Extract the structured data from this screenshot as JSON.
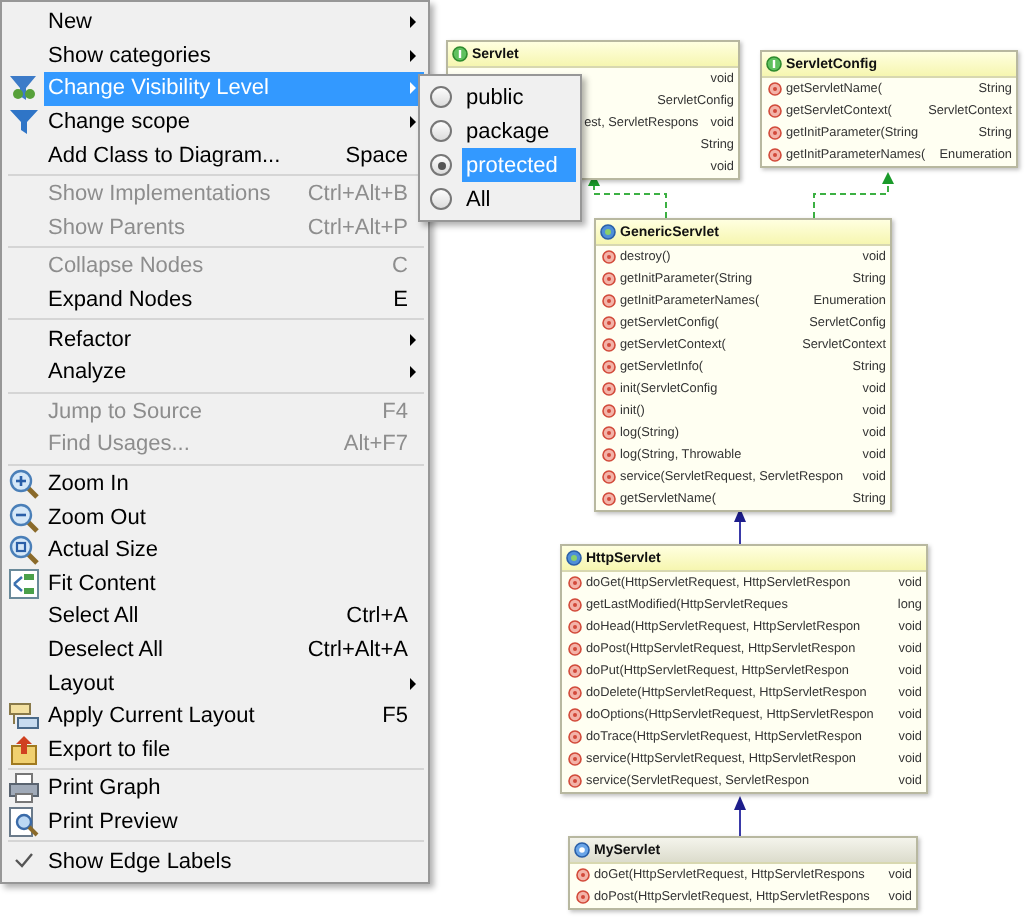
{
  "menu": {
    "items": [
      {
        "kind": "item",
        "label": "New",
        "submenu": true,
        "disabled": false,
        "selected": false
      },
      {
        "kind": "item",
        "label": "Show categories",
        "submenu": true,
        "disabled": false,
        "selected": false
      },
      {
        "kind": "item",
        "label": "Change Visibility Level",
        "submenu": true,
        "disabled": false,
        "selected": true
      },
      {
        "kind": "item",
        "label": "Change scope",
        "submenu": true,
        "disabled": false,
        "selected": false
      },
      {
        "kind": "item",
        "label": "Add Class to Diagram...",
        "shortcut": "Space",
        "submenu": false,
        "disabled": false,
        "selected": false
      },
      {
        "kind": "separator"
      },
      {
        "kind": "item",
        "label": "Show Implementations",
        "shortcut": "Ctrl+Alt+B",
        "submenu": false,
        "disabled": true,
        "selected": false
      },
      {
        "kind": "item",
        "label": "Show Parents",
        "shortcut": "Ctrl+Alt+P",
        "submenu": false,
        "disabled": true,
        "selected": false
      },
      {
        "kind": "separator"
      },
      {
        "kind": "item",
        "label": "Collapse Nodes",
        "shortcut": "C",
        "submenu": false,
        "disabled": true,
        "selected": false
      },
      {
        "kind": "item",
        "label": "Expand Nodes",
        "shortcut": "E",
        "submenu": false,
        "disabled": false,
        "selected": false
      },
      {
        "kind": "separator"
      },
      {
        "kind": "item",
        "label": "Refactor",
        "submenu": true,
        "disabled": false,
        "selected": false
      },
      {
        "kind": "item",
        "label": "Analyze",
        "submenu": true,
        "disabled": false,
        "selected": false
      },
      {
        "kind": "separator"
      },
      {
        "kind": "item",
        "label": "Jump to Source",
        "shortcut": "F4",
        "submenu": false,
        "disabled": true,
        "selected": false
      },
      {
        "kind": "item",
        "label": "Find Usages...",
        "shortcut": "Alt+F7",
        "submenu": false,
        "disabled": true,
        "selected": false
      },
      {
        "kind": "separator"
      },
      {
        "kind": "item",
        "label": "Zoom In",
        "submenu": false,
        "disabled": false,
        "selected": false
      },
      {
        "kind": "item",
        "label": "Zoom Out",
        "submenu": false,
        "disabled": false,
        "selected": false
      },
      {
        "kind": "item",
        "label": "Actual Size",
        "submenu": false,
        "disabled": false,
        "selected": false
      },
      {
        "kind": "item",
        "label": "Fit Content",
        "submenu": false,
        "disabled": false,
        "selected": false
      },
      {
        "kind": "item",
        "label": "Select All",
        "shortcut": "Ctrl+A",
        "submenu": false,
        "disabled": false,
        "selected": false
      },
      {
        "kind": "item",
        "label": "Deselect All",
        "shortcut": "Ctrl+Alt+A",
        "submenu": false,
        "disabled": false,
        "selected": false
      },
      {
        "kind": "item",
        "label": "Layout",
        "submenu": true,
        "disabled": false,
        "selected": false
      },
      {
        "kind": "item",
        "label": "Apply Current Layout",
        "shortcut": "F5",
        "submenu": false,
        "disabled": false,
        "selected": false
      },
      {
        "kind": "item",
        "label": "Export to file",
        "submenu": false,
        "disabled": false,
        "selected": false
      },
      {
        "kind": "separator"
      },
      {
        "kind": "item",
        "label": "Print Graph",
        "submenu": false,
        "disabled": false,
        "selected": false
      },
      {
        "kind": "item",
        "label": "Print Preview",
        "submenu": false,
        "disabled": false,
        "selected": false
      },
      {
        "kind": "separator"
      },
      {
        "kind": "item",
        "label": "Show Edge Labels",
        "submenu": false,
        "disabled": false,
        "selected": false,
        "checked": true
      }
    ]
  },
  "submenu": {
    "items": [
      {
        "label": "public",
        "selected": false
      },
      {
        "label": "package",
        "selected": false
      },
      {
        "label": "protected",
        "selected": true
      },
      {
        "label": "All",
        "selected": false
      }
    ]
  },
  "diagram": {
    "classes": [
      {
        "name": "Servlet",
        "kind": "interface",
        "members": [
          {
            "type": "void"
          },
          {
            "type": "ServletConfig"
          },
          {
            "name": "est, ServletRespons",
            "type": "void"
          },
          {
            "type": "String"
          },
          {
            "type": "void"
          }
        ]
      },
      {
        "name": "ServletConfig",
        "kind": "interface",
        "members": [
          {
            "name": "getServletName(",
            "type": "String"
          },
          {
            "name": "getServletContext(",
            "type": "ServletContext"
          },
          {
            "name": "getInitParameter(String",
            "type": "String"
          },
          {
            "name": "getInitParameterNames(",
            "type": "Enumeration"
          }
        ]
      },
      {
        "name": "GenericServlet",
        "kind": "abstract",
        "members": [
          {
            "name": "destroy()",
            "type": "void"
          },
          {
            "name": "getInitParameter(String",
            "type": "String"
          },
          {
            "name": "getInitParameterNames(",
            "type": "Enumeration"
          },
          {
            "name": "getServletConfig(",
            "type": "ServletConfig"
          },
          {
            "name": "getServletContext(",
            "type": "ServletContext"
          },
          {
            "name": "getServletInfo(",
            "type": "String"
          },
          {
            "name": "init(ServletConfig",
            "type": "void"
          },
          {
            "name": "init()",
            "type": "void"
          },
          {
            "name": "log(String)",
            "type": "void"
          },
          {
            "name": "log(String, Throwable",
            "type": "void"
          },
          {
            "name": "service(ServletRequest, ServletRespon",
            "type": "void"
          },
          {
            "name": "getServletName(",
            "type": "String"
          }
        ]
      },
      {
        "name": "HttpServlet",
        "kind": "abstract",
        "members": [
          {
            "name": "doGet(HttpServletRequest, HttpServletRespon",
            "type": "void"
          },
          {
            "name": "getLastModified(HttpServletReques",
            "type": "long"
          },
          {
            "name": "doHead(HttpServletRequest, HttpServletRespon",
            "type": "void"
          },
          {
            "name": "doPost(HttpServletRequest, HttpServletRespon",
            "type": "void"
          },
          {
            "name": "doPut(HttpServletRequest, HttpServletRespon",
            "type": "void"
          },
          {
            "name": "doDelete(HttpServletRequest, HttpServletRespon",
            "type": "void"
          },
          {
            "name": "doOptions(HttpServletRequest, HttpServletRespon",
            "type": "void"
          },
          {
            "name": "doTrace(HttpServletRequest, HttpServletRespon",
            "type": "void"
          },
          {
            "name": "service(HttpServletRequest, HttpServletRespon",
            "type": "void"
          },
          {
            "name": "service(ServletRequest, ServletRespon",
            "type": "void"
          }
        ]
      },
      {
        "name": "MyServlet",
        "kind": "class",
        "members": [
          {
            "name": "doGet(HttpServletRequest, HttpServletRespons",
            "type": "void"
          },
          {
            "name": "doPost(HttpServletRequest, HttpServletRespons",
            "type": "void"
          }
        ]
      }
    ]
  }
}
